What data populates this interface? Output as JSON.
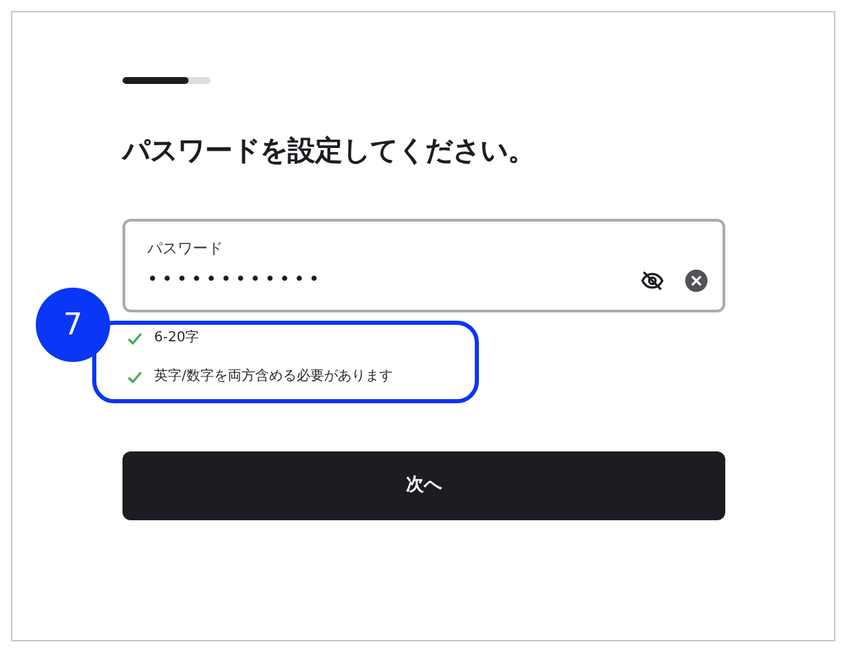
{
  "progress": {
    "level": 0.75
  },
  "heading": "パスワードを設定してください。",
  "password_field": {
    "label": "パスワード",
    "value": "••••••••••••",
    "masked": true
  },
  "requirements": [
    {
      "text": "6-20字",
      "met": true
    },
    {
      "text": "英字/数字を両方含める必要があります",
      "met": true
    }
  ],
  "next_button": "次へ",
  "annotation": {
    "number": "7"
  }
}
